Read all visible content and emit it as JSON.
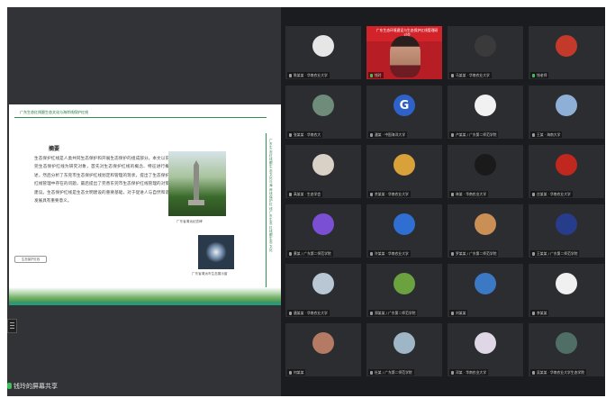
{
  "share_status": "钱玲的屏幕共享",
  "slide": {
    "title": "广东生态红线跟生态文化与海岸线保护红线",
    "heading": "摘要",
    "body": "生态保护红线是人类共同生态保护和开展生态保护的组成部分。本文以东莞生态保护红线为研究对象，首先对生态保护红线的概念、特征进行概述，然后分析了东莞市生态保护红线划定和管理的现状，提出了生态保护红线管理中存在的问题，最后提出了完善东莞市生态保护红线管理的对策建议。生态保护红线是生态文明建设的重要基础，对于促进人与自然和谐发展具有重要意义。",
    "photo1_caption": "广东省清远纪念碑",
    "photo2_caption": "广东省清远市生态展示窗",
    "side_text": "广东生态红线跟生态文化与海岸线保护红线广东生态红线跟生态文化",
    "button_label": "生态保护红线"
  },
  "banner": {
    "text": "广东生态环境建设与生态保护红线管理研讨会"
  },
  "participants": [
    {
      "name": "陈某某 · 华南农业大学",
      "avatar": "photo",
      "avatar_color": "#e6e6e6",
      "mic_on": false
    },
    {
      "name": "钱玲",
      "avatar": "video",
      "avatar_color": "#d2232a",
      "mic_on": true
    },
    {
      "name": "马某某 · 华南农业大学",
      "avatar": "photo",
      "avatar_color": "#3a3a3a",
      "mic_on": false
    },
    {
      "name": "钱老师",
      "avatar": "photo",
      "avatar_color": "#c43a2a",
      "mic_on": true
    },
    {
      "name": "张某某 · 华南农大",
      "avatar": "photo",
      "avatar_color": "#6f8b7a",
      "mic_on": false
    },
    {
      "name": "潘某 · 中国海洋大学",
      "avatar": "letter-g",
      "avatar_color": "#2f62c9",
      "mic_on": false
    },
    {
      "name": "卢某某 / 广东第二师范学院",
      "avatar": "photo",
      "avatar_color": "#f1f1f1",
      "mic_on": false
    },
    {
      "name": "王某 · 海南大学",
      "avatar": "photo",
      "avatar_color": "#8fb0d6",
      "mic_on": false
    },
    {
      "name": "高某某 · 生态学会",
      "avatar": "photo",
      "avatar_color": "#d9d0c6",
      "mic_on": false
    },
    {
      "name": "余某某 · 华南农业大学",
      "avatar": "photo",
      "avatar_color": "#d8a13a",
      "mic_on": false
    },
    {
      "name": "林某 · 华南农业大学",
      "avatar": "photo",
      "avatar_color": "#1a1a1a",
      "mic_on": false
    },
    {
      "name": "庄某某 · 华南农业大学",
      "avatar": "photo",
      "avatar_color": "#c0281f",
      "mic_on": false
    },
    {
      "name": "黄某 / 广东第二师范学院",
      "avatar": "photo",
      "avatar_color": "#7b4fd4",
      "mic_on": false
    },
    {
      "name": "许某某 · 华南农业大学",
      "avatar": "photo",
      "avatar_color": "#2f6fd1",
      "mic_on": false
    },
    {
      "name": "罗某某 / 广东第二师范学院",
      "avatar": "photo",
      "avatar_color": "#c98f55",
      "mic_on": false
    },
    {
      "name": "王某某 / 广东第二师范学院",
      "avatar": "photo",
      "avatar_color": "#283c8c",
      "mic_on": false
    },
    {
      "name": "唐某某 · 华南农业大学",
      "avatar": "photo",
      "avatar_color": "#b9c7d4",
      "mic_on": false
    },
    {
      "name": "郑某某 / 广东第二师范学院",
      "avatar": "photo",
      "avatar_color": "#6ca140",
      "mic_on": false
    },
    {
      "name": "刘某某",
      "avatar": "photo",
      "avatar_color": "#3b79c4",
      "mic_on": false
    },
    {
      "name": "李某某",
      "avatar": "photo",
      "avatar_color": "#f0f0f0",
      "mic_on": false
    },
    {
      "name": "何某某",
      "avatar": "photo",
      "avatar_color": "#b57a63",
      "mic_on": false
    },
    {
      "name": "杜某 / 广东第二师范学院",
      "avatar": "photo",
      "avatar_color": "#9fb6c7",
      "mic_on": false
    },
    {
      "name": "邓某 · 华南农业大学",
      "avatar": "photo",
      "avatar_color": "#e0d7e6",
      "mic_on": false
    },
    {
      "name": "吴某某 · 华南农业大学生态学院",
      "avatar": "photo",
      "avatar_color": "#4f6f66",
      "mic_on": false
    }
  ]
}
